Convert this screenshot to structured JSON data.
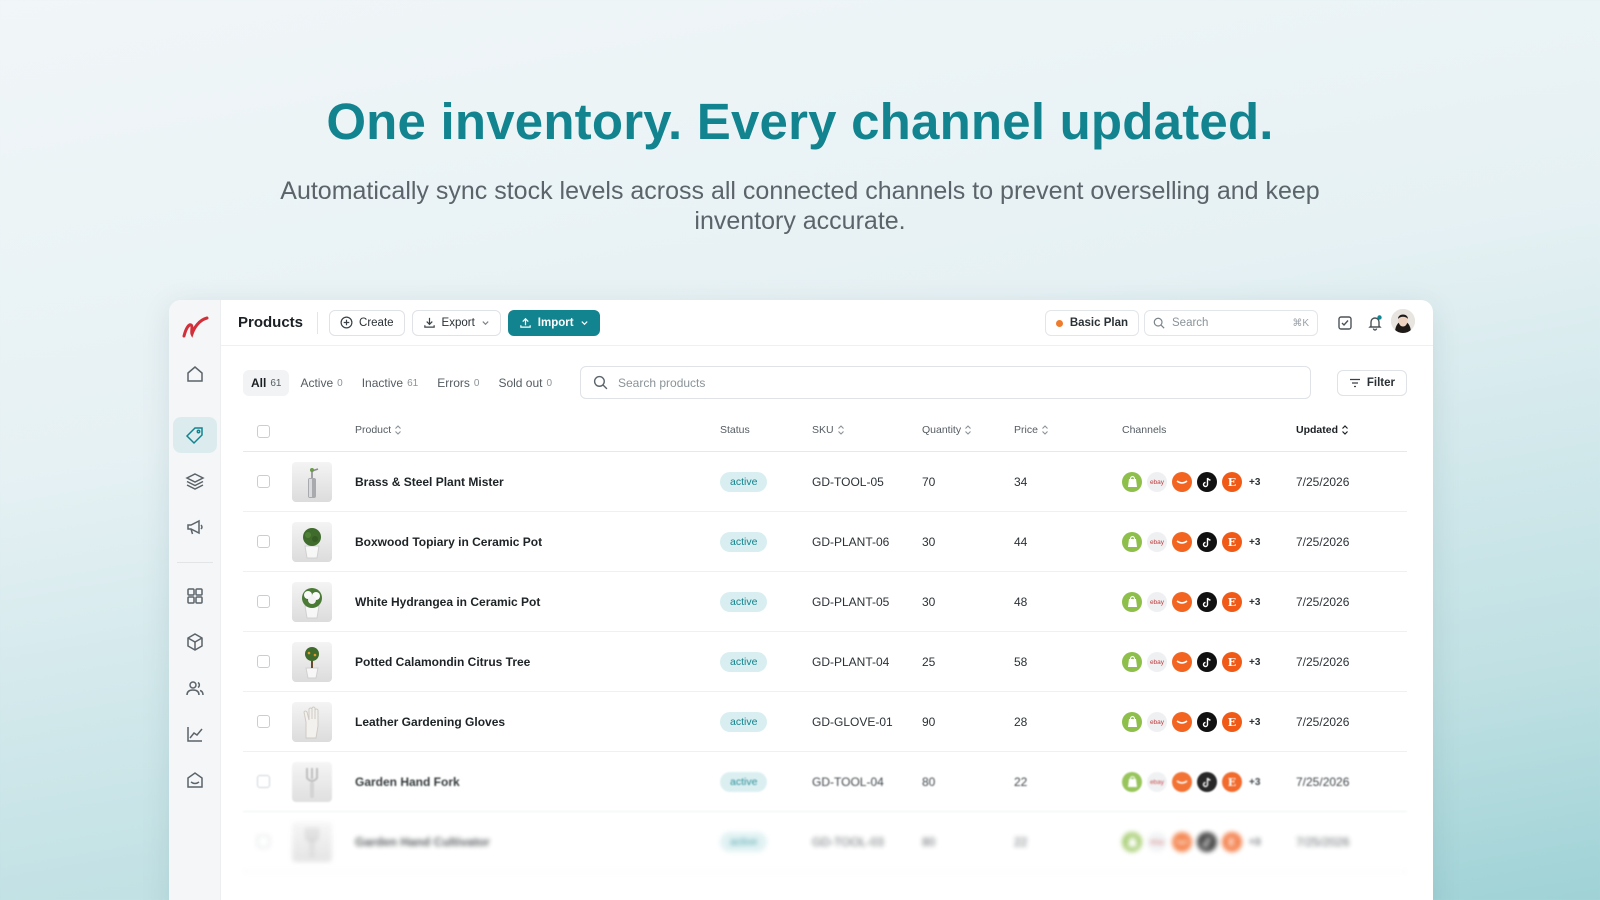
{
  "hero": {
    "title": "One inventory. Every channel updated.",
    "subtitle": "Automatically sync stock levels across all connected channels to prevent overselling and keep inventory accurate."
  },
  "topbar": {
    "title": "Products",
    "create_label": "Create",
    "export_label": "Export",
    "import_label": "Import",
    "plan_label": "Basic Plan",
    "search_placeholder": "Search",
    "search_shortcut": "⌘K"
  },
  "colors": {
    "accent": "#12848f",
    "plan_dot": "#f07b2c",
    "status_bg": "#d8eef0"
  },
  "tabs": [
    {
      "label": "All",
      "count": "61"
    },
    {
      "label": "Active",
      "count": "0"
    },
    {
      "label": "Inactive",
      "count": "61"
    },
    {
      "label": "Errors",
      "count": "0"
    },
    {
      "label": "Sold out",
      "count": "0"
    }
  ],
  "product_search": {
    "placeholder": "Search products"
  },
  "filter_label": "Filter",
  "columns": {
    "product": "Product",
    "status": "Status",
    "sku": "SKU",
    "quantity": "Quantity",
    "price": "Price",
    "channels": "Channels",
    "updated": "Updated"
  },
  "channels": {
    "icons": [
      "shopify-icon",
      "ebay-icon",
      "amazon-icon",
      "tiktok-icon",
      "etsy-icon"
    ],
    "ebay_text": "ebay",
    "etsy_text": "E",
    "more": "+3"
  },
  "rows": [
    {
      "name": "Brass & Steel Plant Mister",
      "status": "active",
      "sku": "GD-TOOL-05",
      "quantity": "70",
      "price": "34",
      "updated": "7/25/2026",
      "thumb": "mister"
    },
    {
      "name": "Boxwood Topiary in Ceramic Pot",
      "status": "active",
      "sku": "GD-PLANT-06",
      "quantity": "30",
      "price": "44",
      "updated": "7/25/2026",
      "thumb": "plant"
    },
    {
      "name": "White Hydrangea in Ceramic Pot",
      "status": "active",
      "sku": "GD-PLANT-05",
      "quantity": "30",
      "price": "48",
      "updated": "7/25/2026",
      "thumb": "flower"
    },
    {
      "name": "Potted Calamondin Citrus Tree",
      "status": "active",
      "sku": "GD-PLANT-04",
      "quantity": "25",
      "price": "58",
      "updated": "7/25/2026",
      "thumb": "tree"
    },
    {
      "name": "Leather Gardening Gloves",
      "status": "active",
      "sku": "GD-GLOVE-01",
      "quantity": "90",
      "price": "28",
      "updated": "7/25/2026",
      "thumb": "glove"
    },
    {
      "name": "Garden Hand Fork",
      "status": "active",
      "sku": "GD-TOOL-04",
      "quantity": "80",
      "price": "22",
      "updated": "7/25/2026",
      "thumb": "fork"
    },
    {
      "name": "Garden Hand Cultivator",
      "status": "active",
      "sku": "GD-TOOL-03",
      "quantity": "80",
      "price": "22",
      "updated": "7/25/2026",
      "thumb": "fork"
    }
  ]
}
